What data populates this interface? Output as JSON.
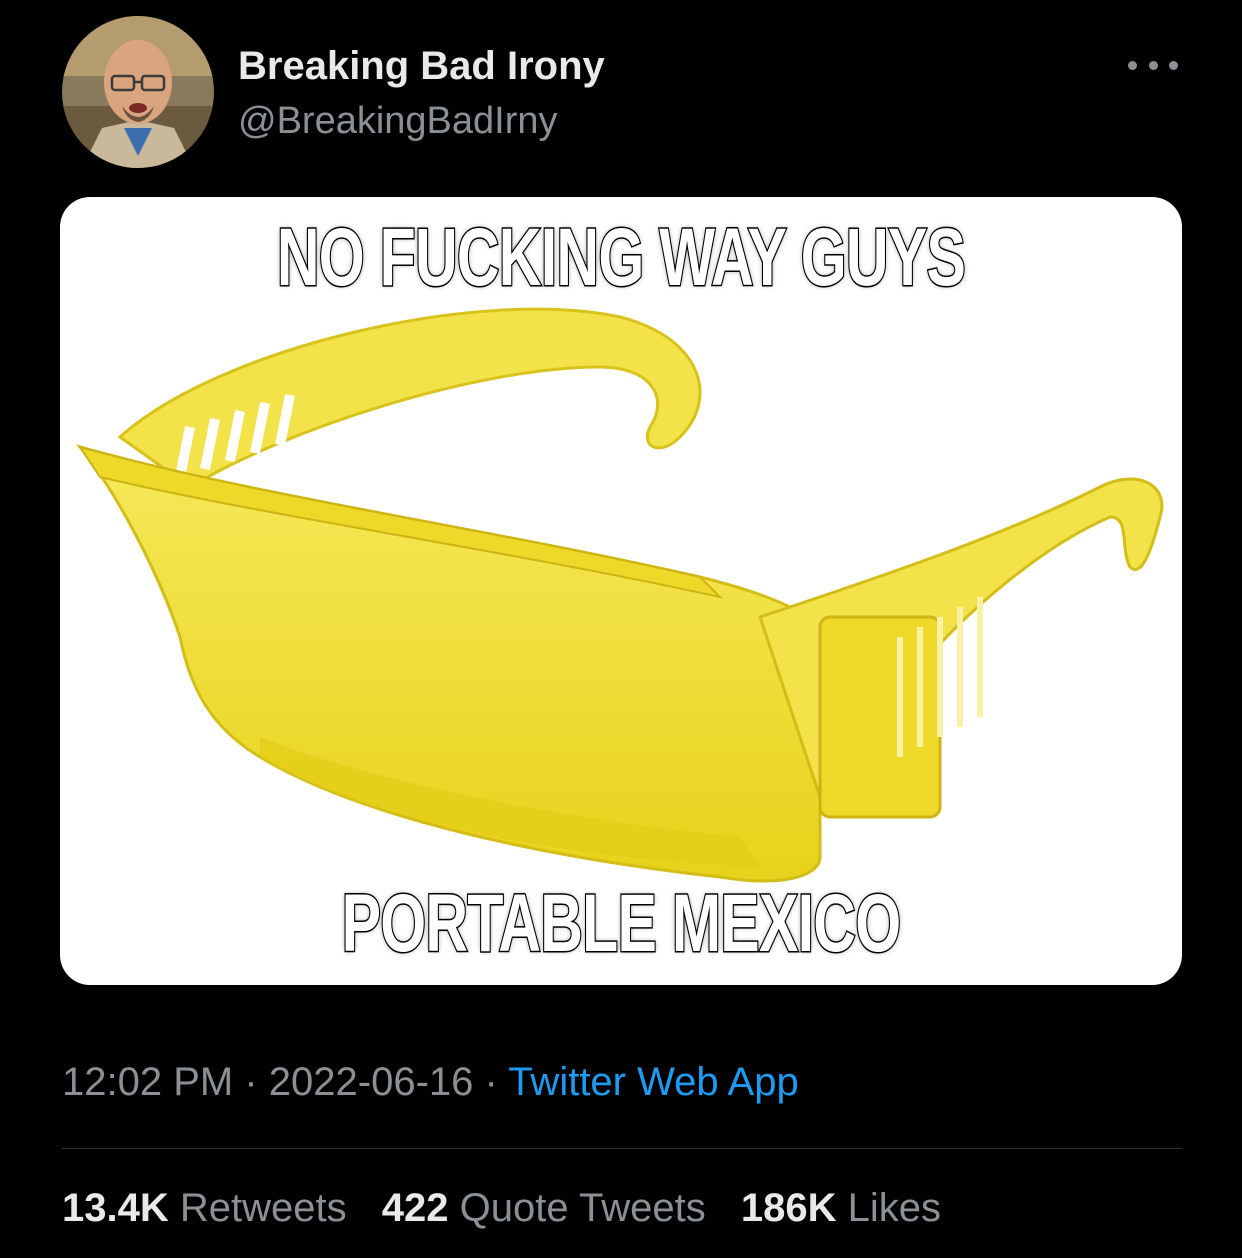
{
  "tweet": {
    "author": {
      "display_name": "Breaking Bad Irony",
      "handle": "@BreakingBadIrny"
    },
    "media": {
      "top_text": "NO FUCKING WAY GUYS",
      "bottom_text": "PORTABLE MEXICO",
      "glasses_color": "#f2e12a"
    },
    "meta": {
      "time": "12:02 PM",
      "separator": " · ",
      "date": "2022-06-16",
      "source": "Twitter Web App"
    },
    "stats": {
      "retweets_count": "13.4K",
      "retweets_label": "Retweets",
      "quotes_count": "422",
      "quotes_label": "Quote Tweets",
      "likes_count": "186K",
      "likes_label": "Likes"
    }
  },
  "colors": {
    "background": "#000000",
    "primary_text": "#e7e9ea",
    "secondary_text": "#8b9096",
    "link": "#1d9bf0",
    "divider": "#2f3336"
  }
}
